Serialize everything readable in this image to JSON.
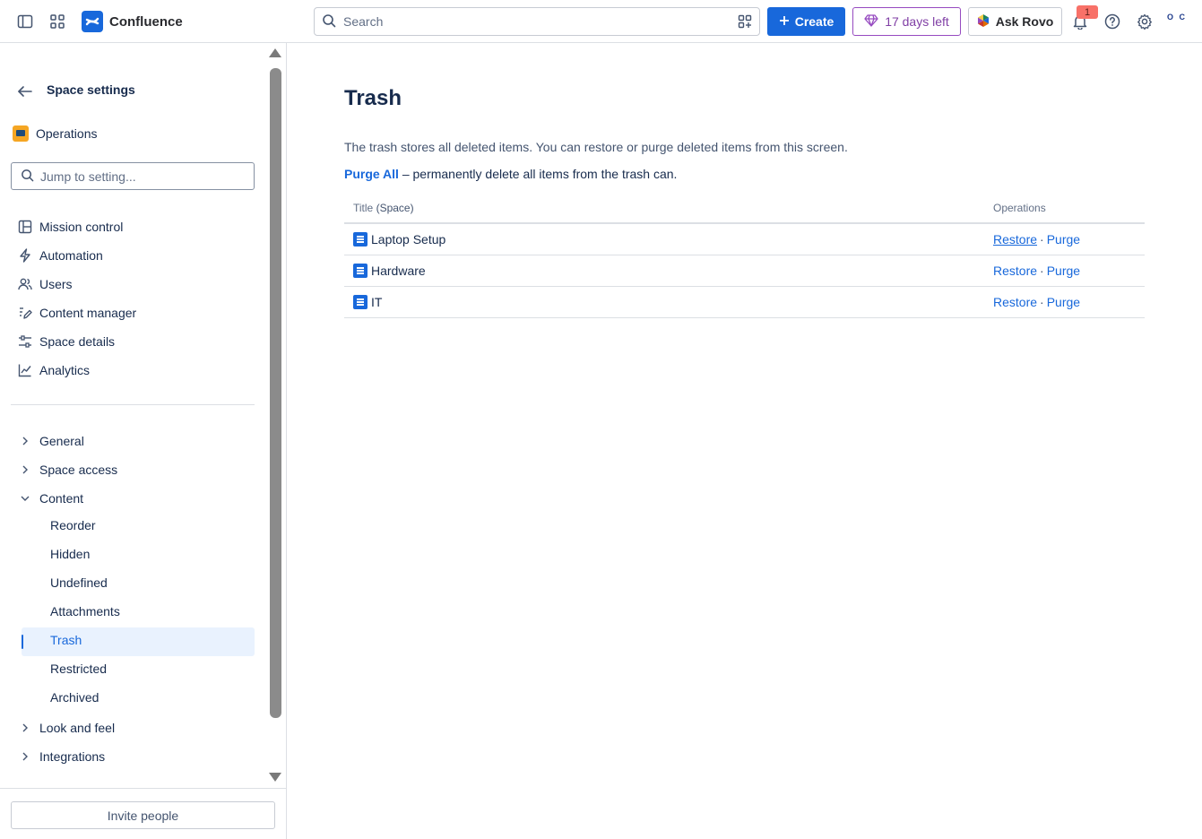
{
  "topbar": {
    "app_name": "Confluence",
    "search_placeholder": "Search",
    "create_label": "Create",
    "trial_label": "17 days left",
    "rovo_label": "Ask Rovo",
    "notification_count": "1",
    "avatar_text": "O C"
  },
  "sidebar": {
    "title": "Space settings",
    "space_name": "Operations",
    "jump_placeholder": "Jump to setting...",
    "nav": [
      {
        "label": "Mission control",
        "icon": "layout-icon"
      },
      {
        "label": "Automation",
        "icon": "lightning-icon"
      },
      {
        "label": "Users",
        "icon": "people-icon"
      },
      {
        "label": "Content manager",
        "icon": "edit-icon"
      },
      {
        "label": "Space details",
        "icon": "sliders-icon"
      },
      {
        "label": "Analytics",
        "icon": "chart-line-icon"
      }
    ],
    "groups": {
      "general": "General",
      "space_access": "Space access",
      "content": "Content",
      "look_and_feel": "Look and feel",
      "integrations": "Integrations"
    },
    "content_items": [
      "Reorder",
      "Hidden",
      "Undefined",
      "Attachments",
      "Trash",
      "Restricted",
      "Archived"
    ],
    "active_item": "Trash",
    "invite_label": "Invite people"
  },
  "main": {
    "title": "Trash",
    "description": "The trash stores all deleted items. You can restore or purge deleted items from this screen.",
    "purge_all_label": "Purge All",
    "purge_all_suffix": " – permanently delete all items from the trash can.",
    "table": {
      "col_title": "Title",
      "col_title_suffix": "(Space)",
      "col_ops": "Operations",
      "restore_label": "Restore",
      "purge_label": "Purge",
      "rows": [
        {
          "title": "Laptop Setup"
        },
        {
          "title": "Hardware"
        },
        {
          "title": "IT"
        }
      ]
    }
  },
  "colors": {
    "accent": "#1868db",
    "trial": "#964ac0",
    "active_bg": "#e9f2fe"
  }
}
